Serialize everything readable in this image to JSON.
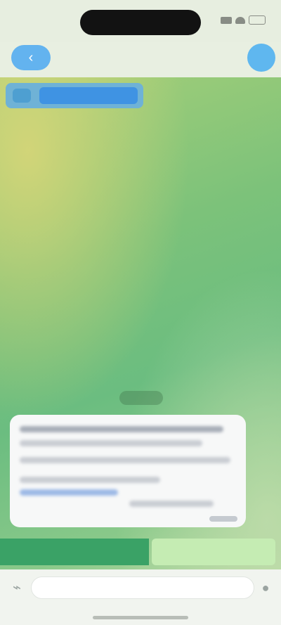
{
  "status_bar": {
    "time": "",
    "icons": [
      "signal-icon",
      "wifi-icon",
      "battery-icon"
    ]
  },
  "header": {
    "back_icon": "chevron-left-icon",
    "title": "",
    "subtitle": "",
    "avatar_icon": "avatar"
  },
  "pinned": {
    "text": ""
  },
  "colors": {
    "accent": "#3f93e3",
    "header_button": "#63b3ef",
    "keyboard_button_primary": "#3aa266",
    "keyboard_button_secondary": "#c5ecb3",
    "message_bubble": "#f7f8f8"
  },
  "message": {
    "date_chip": "",
    "time": ""
  },
  "keyboard_buttons": [
    {
      "label": ""
    },
    {
      "label": ""
    }
  ],
  "composer": {
    "placeholder": "",
    "attach_icon": "paperclip-icon",
    "mic_icon": "microphone-icon"
  }
}
